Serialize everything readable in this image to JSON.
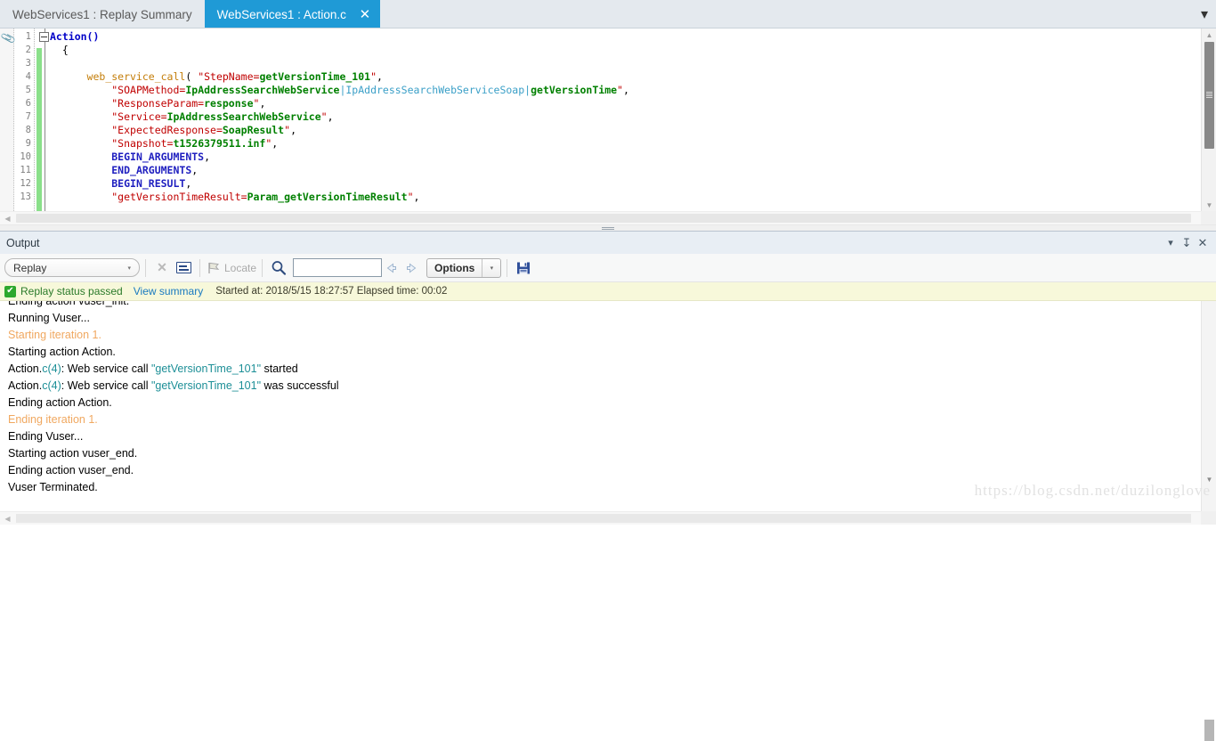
{
  "tabs": [
    {
      "label": "WebServices1 : Replay Summary",
      "active": false
    },
    {
      "label": "WebServices1 : Action.c",
      "active": true,
      "close_glyph": "✕"
    }
  ],
  "tabbar": {
    "overflow_glyph": "▾"
  },
  "editor": {
    "line_numbers": [
      "1",
      "2",
      "3",
      "4",
      "5",
      "6",
      "7",
      "8",
      "9",
      "10",
      "11",
      "12",
      "13"
    ],
    "clip_icon": "📎",
    "code_lines": [
      {
        "tokens": [
          {
            "t": "Action()",
            "c": "kw"
          }
        ]
      },
      {
        "tokens": [
          {
            "t": "  {",
            "c": "plain"
          }
        ]
      },
      {
        "tokens": [
          {
            "t": "",
            "c": "plain"
          }
        ]
      },
      {
        "tokens": [
          {
            "t": "      ",
            "c": "plain"
          },
          {
            "t": "web_service_call",
            "c": "fnc"
          },
          {
            "t": "( ",
            "c": "plain"
          },
          {
            "t": "\"StepName=",
            "c": "str"
          },
          {
            "t": "getVersionTime_101",
            "c": "strg"
          },
          {
            "t": "\"",
            "c": "str"
          },
          {
            "t": ",",
            "c": "plain"
          }
        ]
      },
      {
        "tokens": [
          {
            "t": "          ",
            "c": "plain"
          },
          {
            "t": "\"SOAPMethod=",
            "c": "str"
          },
          {
            "t": "IpAddressSearchWebService",
            "c": "strg"
          },
          {
            "t": "|",
            "c": "cyan"
          },
          {
            "t": "IpAddressSearchWebServiceSoap",
            "c": "cyan"
          },
          {
            "t": "|",
            "c": "cyan"
          },
          {
            "t": "getVersionTime",
            "c": "strg"
          },
          {
            "t": "\"",
            "c": "str"
          },
          {
            "t": ",",
            "c": "plain"
          }
        ]
      },
      {
        "tokens": [
          {
            "t": "          ",
            "c": "plain"
          },
          {
            "t": "\"ResponseParam=",
            "c": "str"
          },
          {
            "t": "response",
            "c": "strg"
          },
          {
            "t": "\"",
            "c": "str"
          },
          {
            "t": ",",
            "c": "plain"
          }
        ]
      },
      {
        "tokens": [
          {
            "t": "          ",
            "c": "plain"
          },
          {
            "t": "\"Service=",
            "c": "str"
          },
          {
            "t": "IpAddressSearchWebService",
            "c": "strg"
          },
          {
            "t": "\"",
            "c": "str"
          },
          {
            "t": ",",
            "c": "plain"
          }
        ]
      },
      {
        "tokens": [
          {
            "t": "          ",
            "c": "plain"
          },
          {
            "t": "\"ExpectedResponse=",
            "c": "str"
          },
          {
            "t": "SoapResult",
            "c": "strg"
          },
          {
            "t": "\"",
            "c": "str"
          },
          {
            "t": ",",
            "c": "plain"
          }
        ]
      },
      {
        "tokens": [
          {
            "t": "          ",
            "c": "plain"
          },
          {
            "t": "\"Snapshot=",
            "c": "str"
          },
          {
            "t": "t1526379511.inf",
            "c": "strg"
          },
          {
            "t": "\"",
            "c": "str"
          },
          {
            "t": ",",
            "c": "plain"
          }
        ]
      },
      {
        "tokens": [
          {
            "t": "          ",
            "c": "plain"
          },
          {
            "t": "BEGIN_ARGUMENTS",
            "c": "bluebold"
          },
          {
            "t": ",",
            "c": "plain"
          }
        ]
      },
      {
        "tokens": [
          {
            "t": "          ",
            "c": "plain"
          },
          {
            "t": "END_ARGUMENTS",
            "c": "bluebold"
          },
          {
            "t": ",",
            "c": "plain"
          }
        ]
      },
      {
        "tokens": [
          {
            "t": "          ",
            "c": "plain"
          },
          {
            "t": "BEGIN_RESULT",
            "c": "bluebold"
          },
          {
            "t": ",",
            "c": "plain"
          }
        ]
      },
      {
        "tokens": [
          {
            "t": "          ",
            "c": "plain"
          },
          {
            "t": "\"getVersionTimeResult=",
            "c": "str"
          },
          {
            "t": "Param_getVersionTimeResult",
            "c": "strg"
          },
          {
            "t": "\"",
            "c": "str"
          },
          {
            "t": ",",
            "c": "plain"
          }
        ]
      }
    ],
    "vscroll": {
      "up_glyph": "▲",
      "down_glyph": "▼"
    },
    "hscroll": {
      "left_glyph": "◀"
    }
  },
  "output": {
    "title": "Output",
    "titlebar_buttons": [
      {
        "name": "dropdown",
        "glyph": "▾"
      },
      {
        "name": "pin",
        "glyph": "↧"
      },
      {
        "name": "close",
        "glyph": "✕"
      }
    ],
    "toolbar": {
      "source_combo": {
        "value": "Replay",
        "arrow": "▾"
      },
      "clear_glyph": "✕",
      "wordwrap_name": "word-wrap",
      "locate_label": "Locate",
      "search_value": "",
      "search_placeholder": "",
      "prev_glyph": "◁",
      "next_glyph": "▷",
      "options_label": "Options",
      "options_arrow": "▾"
    },
    "status": {
      "check_glyph": "✔",
      "passed_text": "Replay status passed",
      "view_summary": "View summary",
      "meta": "Started at: 2018/5/15 18:27:57 Elapsed time: 00:02"
    },
    "log_lines": [
      {
        "segs": [
          {
            "t": "Ending action vuser_init.",
            "c": "plain"
          }
        ]
      },
      {
        "segs": [
          {
            "t": "Running Vuser...",
            "c": "plain"
          }
        ]
      },
      {
        "segs": [
          {
            "t": "Starting iteration 1.",
            "c": "orange"
          }
        ]
      },
      {
        "segs": [
          {
            "t": "Starting action Action.",
            "c": "plain"
          }
        ]
      },
      {
        "segs": [
          {
            "t": "Action.",
            "c": "plain"
          },
          {
            "t": "c(4)",
            "c": "teal"
          },
          {
            "t": ": Web service call ",
            "c": "plain"
          },
          {
            "t": "\"getVersionTime_101\"",
            "c": "teal"
          },
          {
            "t": " started",
            "c": "plain"
          }
        ]
      },
      {
        "segs": [
          {
            "t": "Action.",
            "c": "plain"
          },
          {
            "t": "c(4)",
            "c": "teal"
          },
          {
            "t": ": Web service call ",
            "c": "plain"
          },
          {
            "t": "\"getVersionTime_101\"",
            "c": "teal"
          },
          {
            "t": " was successful",
            "c": "plain"
          }
        ]
      },
      {
        "segs": [
          {
            "t": "Ending action Action.",
            "c": "plain"
          }
        ]
      },
      {
        "segs": [
          {
            "t": "Ending iteration 1.",
            "c": "orange"
          }
        ]
      },
      {
        "segs": [
          {
            "t": "Ending Vuser...",
            "c": "plain"
          }
        ]
      },
      {
        "segs": [
          {
            "t": "Starting action vuser_end.",
            "c": "plain"
          }
        ]
      },
      {
        "segs": [
          {
            "t": "Ending action vuser_end.",
            "c": "plain"
          }
        ]
      },
      {
        "segs": [
          {
            "t": "Vuser Terminated.",
            "c": "plain"
          }
        ]
      }
    ],
    "scroll": {
      "down_glyph": "▼",
      "left_glyph": "◀"
    }
  },
  "watermark": "https://blog.csdn.net/duzilonglove",
  "colors": {
    "accent_tab": "#1f9ad6",
    "status_pass": "#2a7a2a",
    "status_bg": "#f7f8da",
    "link": "#1a7ac0",
    "change_bar": "#8ae08a",
    "log_orange": "#f0a860",
    "log_teal": "#1d8f97"
  }
}
